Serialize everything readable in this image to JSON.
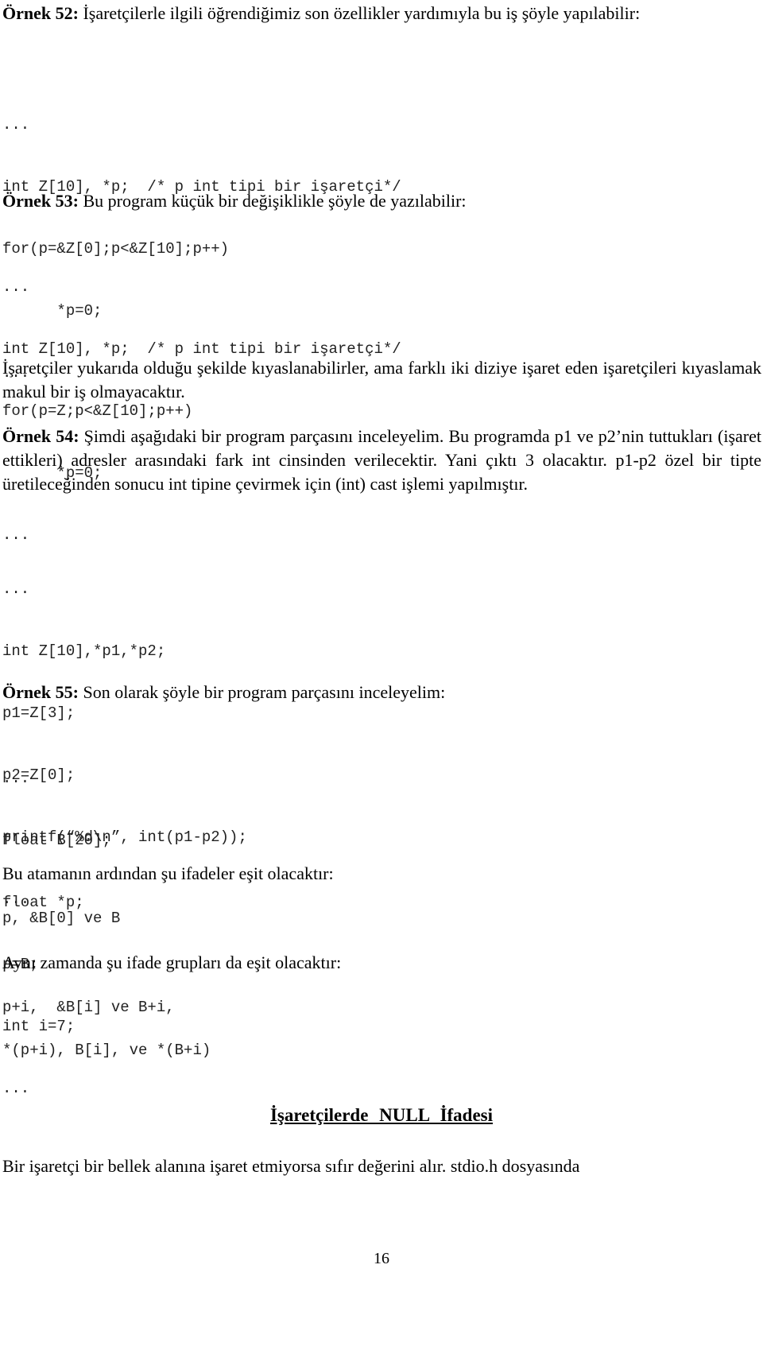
{
  "ex52": {
    "label": "Örnek 52:",
    "text": " İşaretçilerle ilgili öğrendiğimiz son özellikler yardımıyla bu iş şöyle yapılabilir:",
    "code": [
      "...",
      "int Z[10], *p;  /* p int tipi bir işaretçi*/",
      "for(p=&Z[0];p<&Z[10];p++)",
      "      *p=0;",
      "..."
    ]
  },
  "ex53": {
    "label": "Örnek 53:",
    "text": " Bu program küçük bir değişiklikle şöyle de yazılabilir:",
    "code": [
      "...",
      "int Z[10], *p;  /* p int tipi bir işaretçi*/",
      "for(p=Z;p<&Z[10];p++)",
      "      *p=0;",
      "..."
    ]
  },
  "para_compare": "İşaretçiler yukarıda olduğu şekilde kıyaslanabilirler, ama farklı iki diziye işaret eden işaretçileri kıyaslamak makul bir iş olmayacaktır.",
  "ex54": {
    "label": "Örnek 54:",
    "text": " Şimdi aşağıdaki bir program parçasını inceleyelim. Bu programda p1 ve p2’nin tuttukları (işaret ettikleri) adresler arasındaki fark int cinsinden verilecektir. Yani çıktı 3 olacaktır. p1-p2 özel bir tipte üretileceğinden sonucu int tipine çevirmek için (int) cast işlemi yapılmıştır.",
    "code": [
      "...",
      "int Z[10],*p1,*p2;",
      "p1=Z[3];",
      "p2=Z[0];",
      "printf(“%d\\n”, int(p1-p2));",
      "..."
    ]
  },
  "ex55": {
    "label": "Örnek 55:",
    "text": " Son olarak şöyle bir program parçasını inceleyelim:",
    "code": [
      "...",
      "float B[20];",
      "float *p;",
      "p=B;",
      "int i=7;",
      "..."
    ]
  },
  "para_equal1": "Bu atamanın ardından şu ifadeler eşit olacaktır:",
  "code_equal1": "p, &B[0] ve B",
  "para_equal2": "Aynı zamanda şu ifade grupları da eşit olacaktır:",
  "code_equal2a": "p+i,  &B[i] ve B+i,",
  "code_equal2b": "*(p+i), B[i], ve *(B+i)",
  "section_heading": "İşaretçilerde NULL İfadesi",
  "para_null": "Bir işaretçi bir bellek alanına işaret etmiyorsa sıfır değerini alır. stdio.h  dosyasında",
  "page_number": "16"
}
